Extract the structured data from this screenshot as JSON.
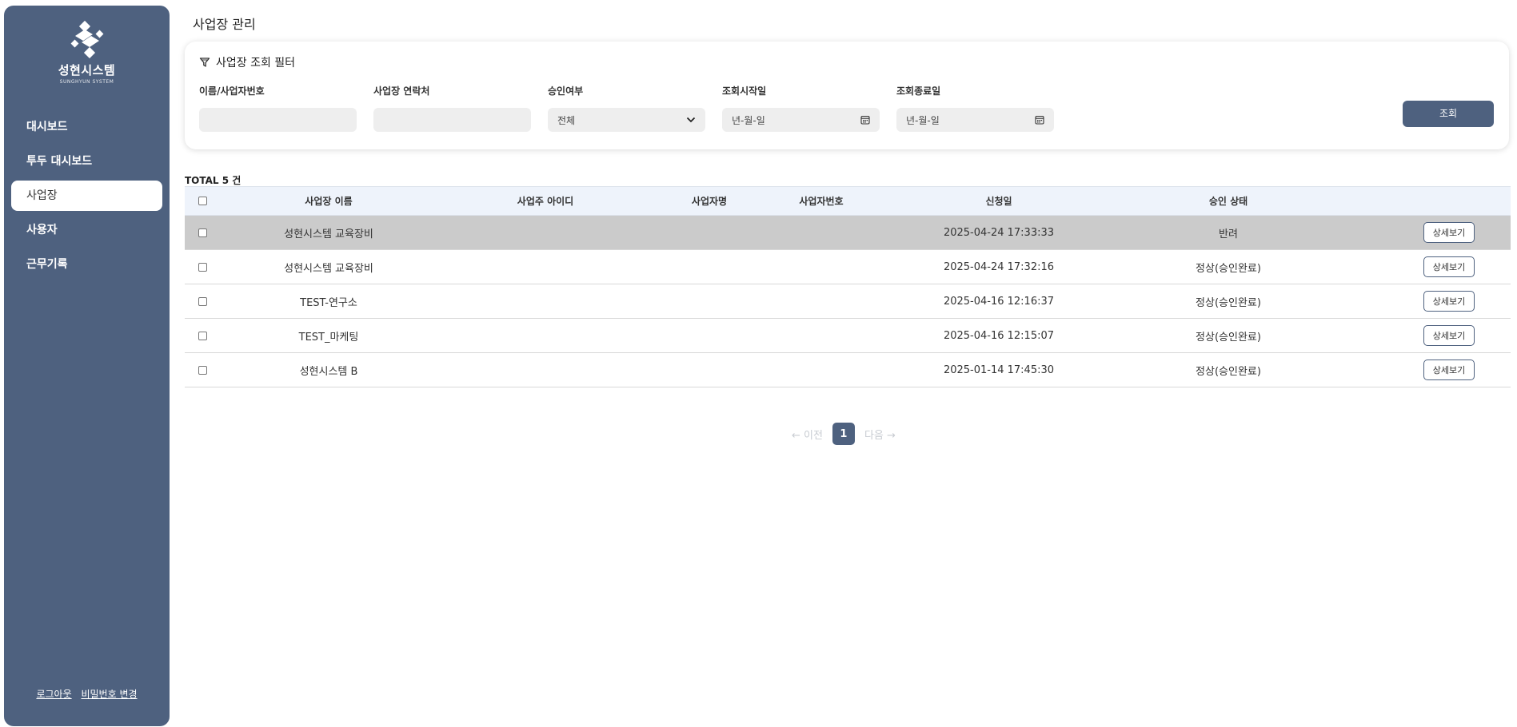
{
  "brand": {
    "name": "성현시스템",
    "sub": "SUNGHYUN SYSTEM"
  },
  "sidebar": {
    "items": [
      {
        "label": "대시보드"
      },
      {
        "label": "투두 대시보드"
      },
      {
        "label": "사업장"
      },
      {
        "label": "사용자"
      },
      {
        "label": "근무기록"
      }
    ],
    "active_index": 2,
    "footer": {
      "logout": "로그아웃",
      "change_password": "비밀번호 변경"
    }
  },
  "page": {
    "title": "사업장 관리"
  },
  "filter": {
    "title": "사업장 조회 필터",
    "fields": {
      "name": {
        "label": "이름/사업자번호",
        "value": ""
      },
      "contact": {
        "label": "사업장 연락처",
        "value": ""
      },
      "approval": {
        "label": "승인여부",
        "value": "전체"
      },
      "start_date": {
        "label": "조회시작일",
        "placeholder": "년-월-일"
      },
      "end_date": {
        "label": "조회종료일",
        "placeholder": "년-월-일"
      }
    },
    "search_label": "조회"
  },
  "table": {
    "total_text": "TOTAL 5 건",
    "columns": [
      "사업장 이름",
      "사업주 아이디",
      "사업자명",
      "사업자번호",
      "신청일",
      "승인 상태"
    ],
    "rows": [
      {
        "name": "성현시스템 교육장비",
        "owner_id": "",
        "business_name": "",
        "business_no": "",
        "date": "2025-04-24 17:33:33",
        "status": "반려",
        "action": "상세보기"
      },
      {
        "name": "성현시스템 교육장비",
        "owner_id": "",
        "business_name": "",
        "business_no": "",
        "date": "2025-04-24 17:32:16",
        "status": "정상(승인완료)",
        "action": "상세보기"
      },
      {
        "name": "TEST-연구소",
        "owner_id": "",
        "business_name": "",
        "business_no": "",
        "date": "2025-04-16 12:16:37",
        "status": "정상(승인완료)",
        "action": "상세보기"
      },
      {
        "name": "TEST_마케팅",
        "owner_id": "",
        "business_name": "",
        "business_no": "",
        "date": "2025-04-16 12:15:07",
        "status": "정상(승인완료)",
        "action": "상세보기"
      },
      {
        "name": "성현시스템 B",
        "owner_id": "",
        "business_name": "",
        "business_no": "",
        "date": "2025-01-14 17:45:30",
        "status": "정상(승인완료)",
        "action": "상세보기"
      }
    ],
    "selected_row_index": 0
  },
  "pagination": {
    "prev": "← 이전",
    "current": "1",
    "next": "다음 →"
  },
  "colors": {
    "sidebar": "#4e617f",
    "selected_row": "#cbcbcb",
    "header_row": "#eef3fb"
  }
}
